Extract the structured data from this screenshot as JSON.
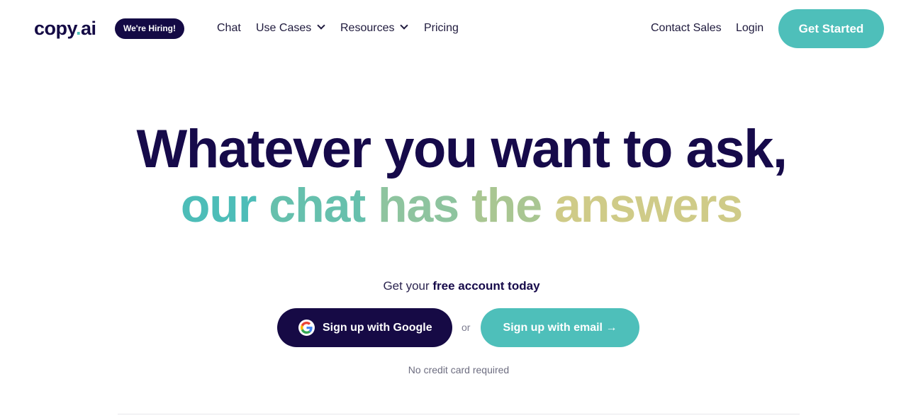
{
  "nav": {
    "logo_main": "copy",
    "logo_dot": ".",
    "logo_suffix": "ai",
    "hiring_badge": "We're Hiring!",
    "links": [
      {
        "label": "Chat"
      },
      {
        "label": "Use Cases",
        "dropdown": true
      },
      {
        "label": "Resources",
        "dropdown": true
      },
      {
        "label": "Pricing"
      }
    ],
    "contact_sales": "Contact Sales",
    "login": "Login",
    "get_started": "Get Started"
  },
  "hero": {
    "line1": "Whatever you want to ask,",
    "line2_words": [
      "our",
      "chat",
      "has",
      "the",
      "answers"
    ],
    "line2_colors": [
      "#4dbdb8",
      "#66c0ad",
      "#8ec49f",
      "#a9c692",
      "#cfcb88"
    ]
  },
  "signup": {
    "prompt_plain": "Get your ",
    "prompt_bold": "free account today",
    "google_label": "Sign up with Google",
    "or": "or",
    "email_label": "Sign up with email →",
    "no_card": "No credit card required"
  },
  "colors": {
    "brand_dark": "#160a45",
    "accent_teal": "#4ebfba"
  }
}
